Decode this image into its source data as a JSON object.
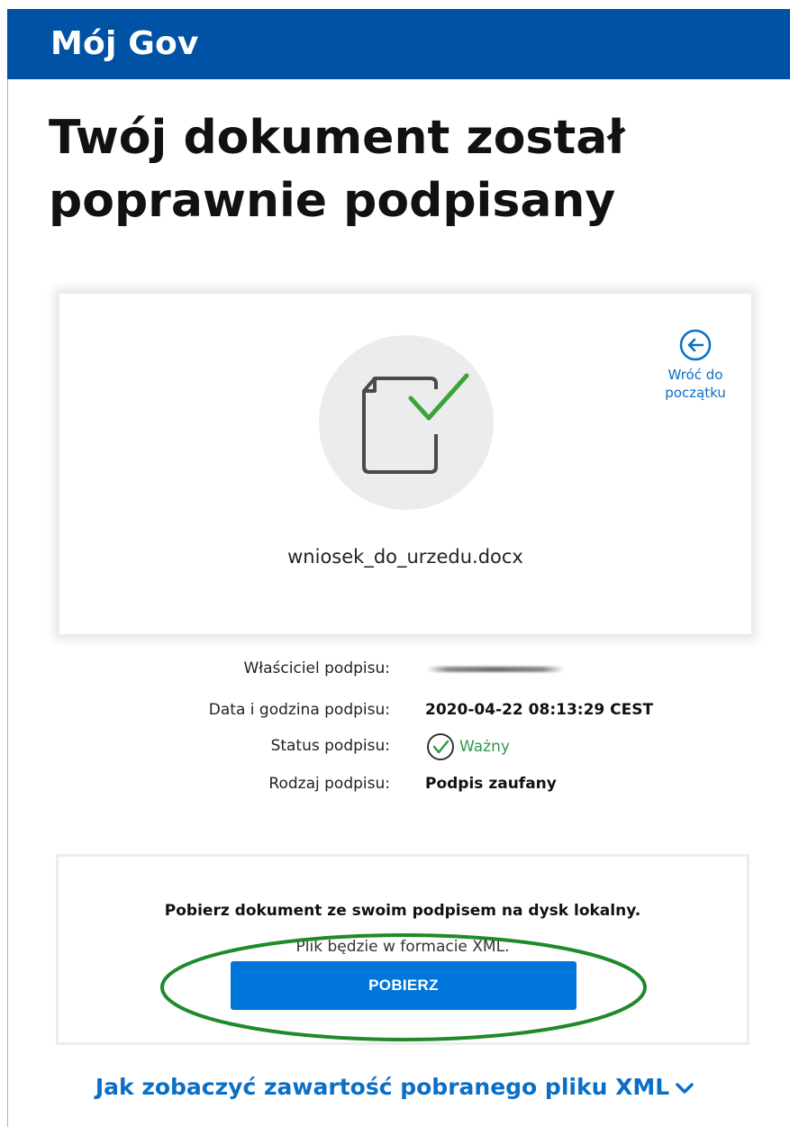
{
  "header": {
    "brand": "Mój Gov"
  },
  "page": {
    "title": "Twój dokument został poprawnie podpisany"
  },
  "card": {
    "back_link_label": "Wróć do początku",
    "file_name": "wniosek_do_urzedu.docx",
    "icons": {
      "document": "document-check-icon",
      "back": "arrow-left-circle-icon"
    }
  },
  "details": {
    "owner_label": "Właściciel podpisu:",
    "date_label": "Data i godzina podpisu:",
    "date_value": "2020-04-22 08:13:29 CEST",
    "status_label": "Status podpisu:",
    "status_value": "Ważny",
    "type_label": "Rodzaj podpisu:",
    "type_value": "Podpis zaufany"
  },
  "download": {
    "title": "Pobierz dokument ze swoim podpisem na dysk lokalny.",
    "subtitle": "Plik będzie w formacie XML.",
    "button_label": "POBIERZ"
  },
  "help": {
    "xml_link": "Jak zobaczyć zawartość pobranego pliku XML"
  },
  "colors": {
    "header_bg": "#0052a5",
    "primary_button": "#0076da",
    "link": "#0b6fc6",
    "valid_green": "#2e9a47",
    "annotation_green": "#1f8a2a"
  }
}
